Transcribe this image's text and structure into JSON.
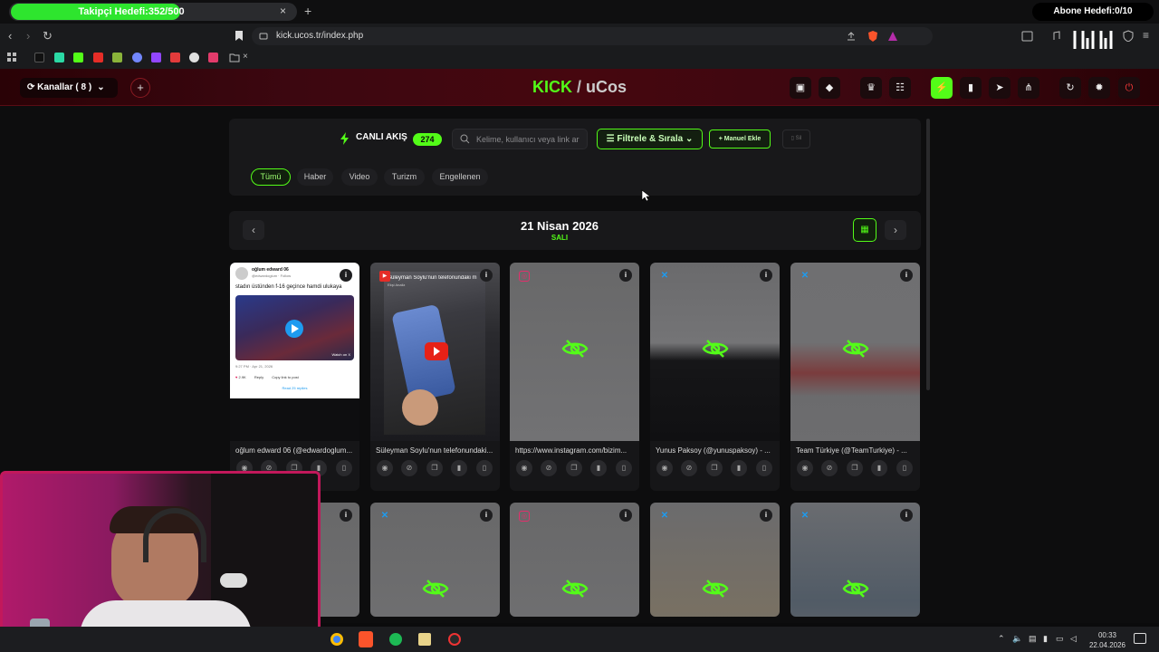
{
  "browser": {
    "tab_title": "Takipçi Hedefi:352/500",
    "tab_progress": 0.704,
    "tab_close": "×",
    "new_tab": "+",
    "overlay_right": "Abone Hedefi:0/10",
    "url": "kick.ucos.tr/index.php",
    "nav": {
      "back": "‹",
      "forward": "›",
      "reload": "↻"
    }
  },
  "header": {
    "channels_label": "Kanallar ( 8 )",
    "add_channel": "+",
    "brand_kick": "KICK",
    "brand_sep": " / ",
    "brand_name": "uCos"
  },
  "filter_panel": {
    "live_label": "CANLI AKIŞ",
    "live_count": "274",
    "search_placeholder": "Kelime, kullanıcı veya link ar",
    "filter_button": "Filtrele & Sırala",
    "manual_button": "+ Manuel Ekle",
    "delete_button": "Sil",
    "chips": [
      "Tümü",
      "Haber",
      "Video",
      "Turizm",
      "Engellenen"
    ]
  },
  "date_bar": {
    "date": "21 Nisan 2026",
    "day": "SALI"
  },
  "cards_row1": [
    {
      "title": "oğlum edward 06 (@edwardoglum...",
      "source": "x"
    },
    {
      "title": "Süleyman Soylu'nun telefonundaki...",
      "source": "youtube"
    },
    {
      "title": "https://www.instagram.com/bizim...",
      "source": "instagram"
    },
    {
      "title": "Yunus Paksoy (@yunuspaksoy) - ...",
      "source": "x"
    },
    {
      "title": "Team Türkiye (@TeamTurkiye) - ...",
      "source": "x"
    }
  ],
  "tweet_preview": {
    "author": "oğlum edward 06",
    "handle": "@edwardoglum · Follow",
    "text": "stadın üstünden f-16 geçince hamdi ulukaya",
    "meta": "9:27 PM · Apr 21, 2026",
    "likes": "2.9K",
    "reply": "Reply",
    "copy": "Copy link to post",
    "read_replies": "Read 25 replies",
    "watch_on": "Watch on X"
  },
  "video_preview": {
    "headline": "Süleyman Soylu'nun telefonundaki m",
    "channel": "Ekşi Analiz"
  },
  "taskbar": {
    "time": "00:33",
    "date": "22.04.2026"
  },
  "colors": {
    "accent": "#53fc18",
    "header_red": "#46070f",
    "webcam_border": "#c2185b"
  }
}
